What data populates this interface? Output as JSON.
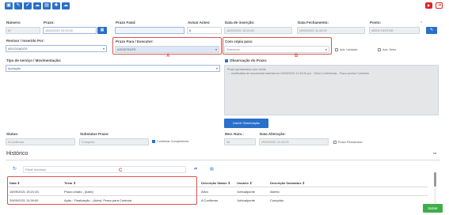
{
  "toolbar": {
    "buttons": [
      "save-icon",
      "edit-icon",
      "check-icon",
      "cloud-icon",
      "document-icon",
      "new-document-icon",
      "cloud-upload-icon"
    ],
    "right_icons": [
      "youtube-icon",
      "exit-icon"
    ]
  },
  "fields": {
    "numero_label": "Número:",
    "numero_value": "67",
    "prazo_label": "Prazo:",
    "prazo_value": "15/09/2021 00:00:00",
    "prazo_fatal_label": "Prazo Fatal:",
    "prazo_fatal_value": "",
    "avisar_label": "Avisar Antes:",
    "avisar_value": "5",
    "data_insercao_label": "Data de inserção:",
    "data_insercao_value": "15/09/2021 15:21:00",
    "data_fechamento_label": "Data Fechamento:",
    "data_fechamento_value": "29/09/2021 11:43:00",
    "posto_label": "Posto:",
    "posto_value": "00006 GESTOR",
    "revisor_label": "Revisor / Inserido Por:",
    "revisor_value": "ADVOGADOS",
    "prazo_para_label": "Prazo Para / Executor:",
    "prazo_para_value": "ASSISTENTE",
    "com_copia_label": "Com cópia para:",
    "com_copia_placeholder": "Selecione",
    "adv_unidade_label": "Adv. Unidade",
    "adv_setor_label": "Adv. Setor",
    "tipo_label": "Tipo de serviço / Movimentação:",
    "tipo_value": "Apelação",
    "observacao_label": "Observação do Prazo:",
    "observacao_lines": [
      "Prazo apresentado com ciente",
      "→ Justificativa de docuemnta inserida em 29/09/2021 11:43:00 por : Setor Conferência - Prazo pronta Controlha"
    ],
    "inserir_obs_button": "Inserir Observação",
    "status_label": "Status:",
    "status_value": "A Confirmar",
    "substatus_label": "Substatus Prazo:",
    "substatus_value": "Cumprido",
    "confirmar_label": "Confirmar Cumprimento",
    "mov_num_label": "Mov. Num.:",
    "mov_num_value": "34",
    "data_alteracao_label": "Data Alteração:",
    "data_alteracao_value": "29/09/2021 11:43:00",
    "prazo_remarcado_label": "Prazo Remarcado"
  },
  "annotations": {
    "a": "A",
    "b": "B",
    "c": "C"
  },
  "historico": {
    "title": "Histórico",
    "more": "•••",
    "filter_placeholder": "Filtrar resultado",
    "columns": [
      "Data ⇕",
      "Texto ⇕",
      "Descrição Status ⇕",
      "Usuário ⇕",
      "Descrição Substatus ⇕"
    ],
    "rows": [
      [
        "15/09/2021 15:21:43",
        "Prazo criado - [Adm]",
        "Ativo",
        "1virtualponte",
        "Aberto"
      ],
      [
        "29/09/2021 11:39:00",
        "Ação : Finalização - (Adm): Prazo para Controla",
        "A Confirmar",
        "1virtualponte",
        "Cumprido"
      ]
    ]
  },
  "salvar_button": "Salvar",
  "colors": {
    "accent": "#2a6fc9",
    "annotation": "#d9534f",
    "success": "#3fae49"
  }
}
